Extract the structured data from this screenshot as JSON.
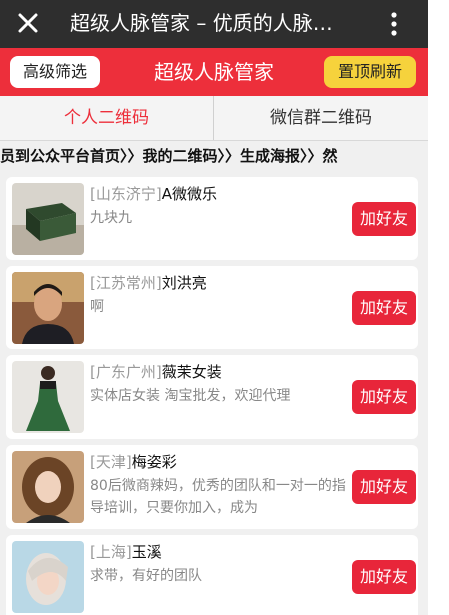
{
  "header": {
    "close_icon": "close-icon",
    "title": "超级人脉管家 – 优质的人脉…",
    "more_icon": "more-vertical-icon"
  },
  "toolbar": {
    "filter_label": "高级筛选",
    "title": "超级人脉管家",
    "refresh_label": "置顶刷新",
    "colors": {
      "red": "#ed2f3b",
      "yellow": "#f6d23c"
    }
  },
  "tabs": [
    {
      "label": "个人二维码",
      "active": true
    },
    {
      "label": "微信群二维码",
      "active": false
    }
  ],
  "breadcrumb": "员到公众平台首页〉〉我的二维码〉〉生成海报〉〉然",
  "list": [
    {
      "location": "[山东济宁]",
      "name": "A微微乐",
      "desc": "九块九",
      "button": "加好友"
    },
    {
      "location": "[江苏常州]",
      "name": "刘洪亮",
      "desc": "啊",
      "button": "加好友"
    },
    {
      "location": "[广东广州]",
      "name": "薇茉女装",
      "desc": "实体店女装 淘宝批发，欢迎代理",
      "button": "加好友"
    },
    {
      "location": "[天津]",
      "name": "梅姿彩",
      "desc": "80后微商辣妈，优秀的团队和一对一的指导培训，只要你加入，成为",
      "button": "加好友"
    },
    {
      "location": "[上海]",
      "name": "玉溪",
      "desc": "求带，有好的团队",
      "button": "加好友"
    }
  ]
}
